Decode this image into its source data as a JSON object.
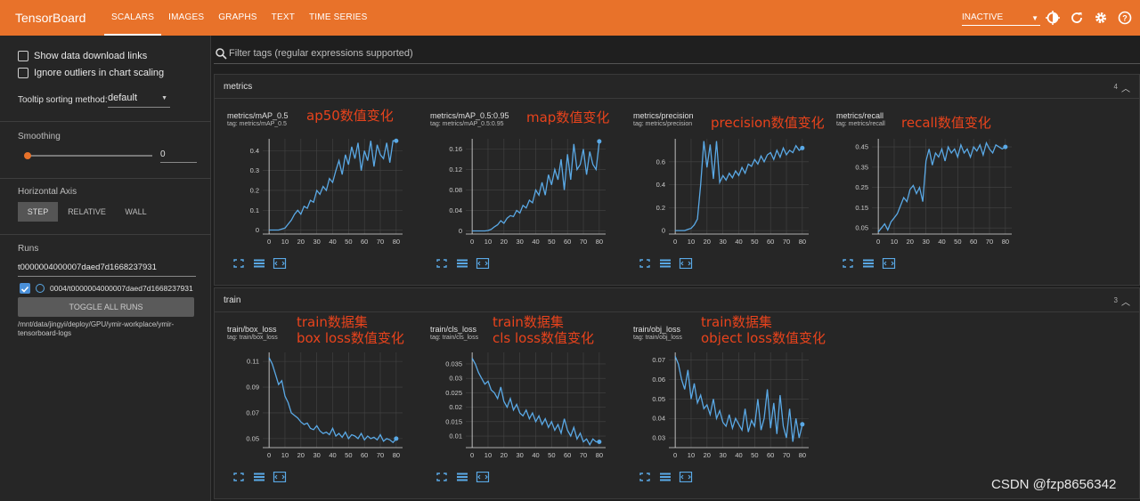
{
  "app": {
    "brand": "TensorBoard"
  },
  "tabs": [
    {
      "label": "SCALARS"
    },
    {
      "label": "IMAGES"
    },
    {
      "label": "GRAPHS"
    },
    {
      "label": "TEXT"
    },
    {
      "label": "TIME SERIES"
    }
  ],
  "run_status": "INACTIVE",
  "sidebar": {
    "show_download": "Show data download links",
    "ignore_outliers": "Ignore outliers in chart scaling",
    "tooltip_label": "Tooltip sorting method:",
    "tooltip_value": "default",
    "smoothing_label": "Smoothing",
    "smoothing_value": "0",
    "haxis_label": "Horizontal Axis",
    "haxis_options": [
      "STEP",
      "RELATIVE",
      "WALL"
    ],
    "runs_label": "Runs",
    "run_filter": "t0000004000007daed7d1668237931",
    "run_item": "0004/t0000004000007daed7d1668237931",
    "toggle_all": "TOGGLE ALL RUNS",
    "logdir": "/mnt/data/jingyi/deploy/GPU/ymir-workplace/ymir-tensorboard-logs"
  },
  "filter_placeholder": "Filter tags (regular expressions supported)",
  "groups": [
    {
      "title": "metrics",
      "count": "4"
    },
    {
      "title": "train",
      "count": "3"
    }
  ],
  "charts": [
    {
      "title": "metrics/mAP_0.5",
      "tag": "tag: metrics/mAP_0.5",
      "annot": [
        "ap50数值变化"
      ]
    },
    {
      "title": "metrics/mAP_0.5:0.95",
      "tag": "tag: metrics/mAP_0.5:0.95",
      "annot": [
        "map数值变化"
      ]
    },
    {
      "title": "metrics/precision",
      "tag": "tag: metrics/precision",
      "annot": [
        "precision数值变化"
      ]
    },
    {
      "title": "metrics/recall",
      "tag": "tag: metrics/recall",
      "annot": [
        "recall数值变化"
      ]
    },
    {
      "title": "train/box_loss",
      "tag": "tag: train/box_loss",
      "annot": [
        "train数据集",
        "box loss数值变化"
      ]
    },
    {
      "title": "train/cls_loss",
      "tag": "tag: train/cls_loss",
      "annot": [
        "train数据集",
        "cls loss数值变化"
      ]
    },
    {
      "title": "train/obj_loss",
      "tag": "tag: train/obj_loss",
      "annot": [
        "train数据集",
        "object loss数值变化"
      ]
    }
  ],
  "colors": {
    "accent": "#e8722a",
    "line": "#5aa9e6",
    "annot": "#e8431c"
  },
  "watermark": "CSDN @fzp8656342",
  "chart_data": [
    {
      "type": "line",
      "title": "metrics/mAP_0.5",
      "x_ticks": [
        0,
        10,
        20,
        30,
        40,
        50,
        60,
        70,
        80
      ],
      "y_ticks": [
        0,
        0.1,
        0.2,
        0.3,
        0.4
      ],
      "ylim": [
        -0.02,
        0.46
      ],
      "xlim": [
        -4,
        84
      ],
      "x": [
        0,
        2,
        4,
        6,
        8,
        10,
        12,
        14,
        16,
        18,
        20,
        22,
        24,
        26,
        28,
        30,
        32,
        34,
        36,
        38,
        40,
        42,
        44,
        46,
        48,
        50,
        52,
        54,
        56,
        58,
        60,
        62,
        64,
        66,
        68,
        70,
        72,
        74,
        76,
        78,
        80
      ],
      "y": [
        0,
        0,
        0,
        0,
        0.005,
        0.01,
        0.03,
        0.05,
        0.08,
        0.1,
        0.08,
        0.12,
        0.11,
        0.15,
        0.14,
        0.2,
        0.18,
        0.22,
        0.2,
        0.26,
        0.24,
        0.3,
        0.35,
        0.28,
        0.38,
        0.33,
        0.42,
        0.36,
        0.44,
        0.3,
        0.4,
        0.35,
        0.45,
        0.32,
        0.43,
        0.38,
        0.36,
        0.44,
        0.34,
        0.45,
        0.45
      ]
    },
    {
      "type": "line",
      "title": "metrics/mAP_0.5:0.95",
      "x_ticks": [
        0,
        10,
        20,
        30,
        40,
        50,
        60,
        70,
        80
      ],
      "y_ticks": [
        0,
        0.04,
        0.08,
        0.12,
        0.16
      ],
      "ylim": [
        -0.006,
        0.18
      ],
      "xlim": [
        -4,
        84
      ],
      "x": [
        0,
        2,
        4,
        6,
        8,
        10,
        12,
        14,
        16,
        18,
        20,
        22,
        24,
        26,
        28,
        30,
        32,
        34,
        36,
        38,
        40,
        42,
        44,
        46,
        48,
        50,
        52,
        54,
        56,
        58,
        60,
        62,
        64,
        66,
        68,
        70,
        72,
        74,
        76,
        78,
        80
      ],
      "y": [
        0,
        0,
        0,
        0,
        0,
        0.001,
        0.003,
        0.008,
        0.012,
        0.02,
        0.015,
        0.025,
        0.03,
        0.028,
        0.04,
        0.035,
        0.05,
        0.045,
        0.06,
        0.055,
        0.08,
        0.07,
        0.095,
        0.07,
        0.11,
        0.09,
        0.12,
        0.1,
        0.14,
        0.08,
        0.15,
        0.1,
        0.17,
        0.12,
        0.13,
        0.16,
        0.11,
        0.155,
        0.13,
        0.12,
        0.175
      ]
    },
    {
      "type": "line",
      "title": "metrics/precision",
      "x_ticks": [
        0,
        10,
        20,
        30,
        40,
        50,
        60,
        70,
        80
      ],
      "y_ticks": [
        0,
        0.2,
        0.4,
        0.6
      ],
      "ylim": [
        -0.03,
        0.8
      ],
      "xlim": [
        -4,
        84
      ],
      "x": [
        0,
        2,
        4,
        6,
        8,
        10,
        12,
        14,
        16,
        18,
        20,
        22,
        24,
        26,
        28,
        30,
        32,
        34,
        36,
        38,
        40,
        42,
        44,
        46,
        48,
        50,
        52,
        54,
        56,
        58,
        60,
        62,
        64,
        66,
        68,
        70,
        72,
        74,
        76,
        78,
        80
      ],
      "y": [
        0,
        0,
        0,
        0,
        0.01,
        0.02,
        0.05,
        0.1,
        0.4,
        0.78,
        0.55,
        0.75,
        0.45,
        0.78,
        0.42,
        0.48,
        0.44,
        0.5,
        0.46,
        0.52,
        0.48,
        0.55,
        0.5,
        0.58,
        0.56,
        0.62,
        0.58,
        0.65,
        0.6,
        0.66,
        0.68,
        0.62,
        0.7,
        0.64,
        0.72,
        0.66,
        0.7,
        0.68,
        0.74,
        0.7,
        0.72
      ]
    },
    {
      "type": "line",
      "title": "metrics/recall",
      "x_ticks": [
        0,
        10,
        20,
        30,
        40,
        50,
        60,
        70,
        80
      ],
      "y_ticks": [
        0.05,
        0.15,
        0.25,
        0.35,
        0.45
      ],
      "ylim": [
        0.02,
        0.49
      ],
      "xlim": [
        -4,
        84
      ],
      "x": [
        0,
        2,
        4,
        6,
        8,
        10,
        12,
        14,
        16,
        18,
        20,
        22,
        24,
        26,
        28,
        30,
        32,
        34,
        36,
        38,
        40,
        42,
        44,
        46,
        48,
        50,
        52,
        54,
        56,
        58,
        60,
        62,
        64,
        66,
        68,
        70,
        72,
        74,
        76,
        78,
        80
      ],
      "y": [
        0.03,
        0.05,
        0.07,
        0.04,
        0.08,
        0.1,
        0.12,
        0.16,
        0.2,
        0.18,
        0.24,
        0.26,
        0.22,
        0.25,
        0.18,
        0.38,
        0.44,
        0.36,
        0.42,
        0.4,
        0.44,
        0.38,
        0.45,
        0.42,
        0.44,
        0.4,
        0.46,
        0.42,
        0.44,
        0.4,
        0.45,
        0.43,
        0.46,
        0.41,
        0.47,
        0.44,
        0.42,
        0.46,
        0.45,
        0.44,
        0.45
      ]
    },
    {
      "type": "line",
      "title": "train/box_loss",
      "x_ticks": [
        0,
        10,
        20,
        30,
        40,
        50,
        60,
        70,
        80
      ],
      "y_ticks": [
        0.05,
        0.07,
        0.09,
        0.11
      ],
      "ylim": [
        0.043,
        0.117
      ],
      "xlim": [
        -4,
        84
      ],
      "x": [
        0,
        2,
        4,
        6,
        8,
        10,
        12,
        14,
        16,
        18,
        20,
        22,
        24,
        26,
        28,
        30,
        32,
        34,
        36,
        38,
        40,
        42,
        44,
        46,
        48,
        50,
        52,
        54,
        56,
        58,
        60,
        62,
        64,
        66,
        68,
        70,
        72,
        74,
        76,
        78,
        80
      ],
      "y": [
        0.113,
        0.108,
        0.1,
        0.092,
        0.095,
        0.083,
        0.078,
        0.07,
        0.068,
        0.066,
        0.063,
        0.061,
        0.062,
        0.058,
        0.057,
        0.06,
        0.056,
        0.054,
        0.055,
        0.053,
        0.058,
        0.052,
        0.054,
        0.051,
        0.055,
        0.05,
        0.053,
        0.052,
        0.05,
        0.054,
        0.049,
        0.052,
        0.05,
        0.051,
        0.049,
        0.053,
        0.048,
        0.05,
        0.049,
        0.047,
        0.05
      ]
    },
    {
      "type": "line",
      "title": "train/cls_loss",
      "x_ticks": [
        0,
        10,
        20,
        30,
        40,
        50,
        60,
        70,
        80
      ],
      "y_ticks": [
        0.01,
        0.015,
        0.02,
        0.025,
        0.03,
        0.035
      ],
      "ylim": [
        0.006,
        0.039
      ],
      "xlim": [
        -4,
        84
      ],
      "x": [
        0,
        2,
        4,
        6,
        8,
        10,
        12,
        14,
        16,
        18,
        20,
        22,
        24,
        26,
        28,
        30,
        32,
        34,
        36,
        38,
        40,
        42,
        44,
        46,
        48,
        50,
        52,
        54,
        56,
        58,
        60,
        62,
        64,
        66,
        68,
        70,
        72,
        74,
        76,
        78,
        80
      ],
      "y": [
        0.037,
        0.035,
        0.032,
        0.03,
        0.028,
        0.029,
        0.026,
        0.025,
        0.023,
        0.027,
        0.022,
        0.02,
        0.023,
        0.019,
        0.021,
        0.018,
        0.017,
        0.019,
        0.016,
        0.018,
        0.015,
        0.017,
        0.014,
        0.016,
        0.013,
        0.015,
        0.012,
        0.014,
        0.011,
        0.016,
        0.012,
        0.01,
        0.013,
        0.009,
        0.011,
        0.008,
        0.009,
        0.007,
        0.009,
        0.008,
        0.008
      ]
    },
    {
      "type": "line",
      "title": "train/obj_loss",
      "x_ticks": [
        0,
        10,
        20,
        30,
        40,
        50,
        60,
        70,
        80
      ],
      "y_ticks": [
        0.03,
        0.04,
        0.05,
        0.06,
        0.07
      ],
      "ylim": [
        0.025,
        0.074
      ],
      "xlim": [
        -4,
        84
      ],
      "x": [
        0,
        2,
        4,
        6,
        8,
        10,
        12,
        14,
        16,
        18,
        20,
        22,
        24,
        26,
        28,
        30,
        32,
        34,
        36,
        38,
        40,
        42,
        44,
        46,
        48,
        50,
        52,
        54,
        56,
        58,
        60,
        62,
        64,
        66,
        68,
        70,
        72,
        74,
        76,
        78,
        80
      ],
      "y": [
        0.072,
        0.068,
        0.06,
        0.055,
        0.065,
        0.05,
        0.058,
        0.048,
        0.052,
        0.045,
        0.047,
        0.042,
        0.05,
        0.04,
        0.044,
        0.038,
        0.036,
        0.042,
        0.035,
        0.04,
        0.037,
        0.034,
        0.045,
        0.033,
        0.039,
        0.036,
        0.05,
        0.034,
        0.04,
        0.055,
        0.035,
        0.048,
        0.032,
        0.052,
        0.036,
        0.03,
        0.045,
        0.028,
        0.04,
        0.03,
        0.037
      ]
    }
  ]
}
